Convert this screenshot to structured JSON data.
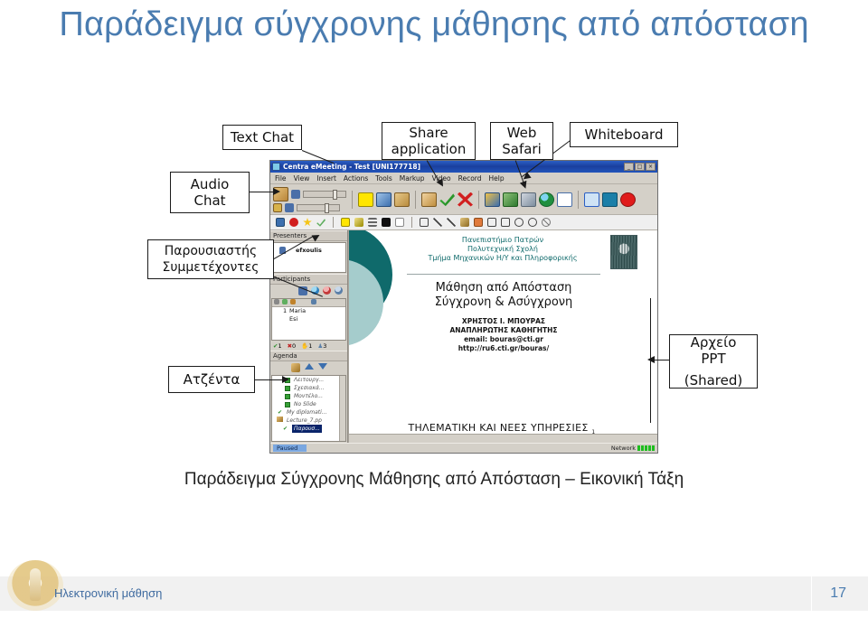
{
  "slide": {
    "title": "Παράδειγμα σύγχρονης μάθησης από απόσταση",
    "title_color": "#4a7cb0",
    "caption": "Παράδειγμα Σύγχρονης Μάθησης από Απόσταση – Εικονική Τάξη"
  },
  "footer": {
    "text": "Ηλεκτρονική μάθηση",
    "page_number": "17",
    "logo_icon": "university-crest-logo"
  },
  "callouts": [
    {
      "id": "text-chat",
      "lines": [
        "Text Chat"
      ]
    },
    {
      "id": "audio-chat",
      "lines": [
        "Audio",
        "Chat"
      ]
    },
    {
      "id": "presenters",
      "lines": [
        "Παρουσιαστής",
        "Συμμετέχοντες"
      ]
    },
    {
      "id": "agenda",
      "lines": [
        "Ατζέντα"
      ]
    },
    {
      "id": "share-app",
      "lines": [
        "Share",
        "application"
      ]
    },
    {
      "id": "web-safari",
      "lines": [
        "Web",
        "Safari"
      ]
    },
    {
      "id": "whiteboard",
      "lines": [
        "Whiteboard"
      ]
    },
    {
      "id": "ppt-file",
      "lines": [
        "Αρχείο",
        "PPT",
        "",
        "(Shared)"
      ]
    }
  ],
  "app": {
    "title": "Centra eMeeting - Test [UNI177718]",
    "window_buttons": [
      "_",
      "□",
      "×"
    ],
    "menu": [
      "File",
      "View",
      "Insert",
      "Actions",
      "Tools",
      "Markup",
      "Video",
      "Record",
      "Help"
    ],
    "panels": {
      "presenters_label": "Presenters",
      "presenter_name": "efxoulis",
      "participants_label": "Participants",
      "participants": [
        {
          "num": "1",
          "name": "Maria"
        },
        {
          "num": "",
          "name": "Esi"
        }
      ],
      "counts": [
        {
          "icon": "check-icon",
          "value": "1"
        },
        {
          "icon": "x-icon",
          "value": "0"
        },
        {
          "icon": "hand-icon",
          "value": "1"
        },
        {
          "icon": "person-icon",
          "value": "3"
        }
      ],
      "agenda_label": "Agenda",
      "agenda_items": [
        "Λειτουργ...",
        "Σχεσιακά...",
        "Μοντέλο...",
        "No Slide",
        "My diplomati...",
        "Lecture_7.pp",
        "Παρουσ..."
      ]
    },
    "stage": {
      "university_lines": [
        "Πανεπιστήμιο Πατρών",
        "Πολυτεχνική Σχολή",
        "Τμήμα Μηχανικών Η/Υ και Πληροφορικής"
      ],
      "crest_icon": "university-crest-icon",
      "heading_lines": [
        "Μάθηση από Απόσταση",
        "Σύγχρονη & Ασύγχρονη"
      ],
      "author_lines": [
        "ΧΡΗΣΤΟΣ Ι. ΜΠΟΥΡΑΣ",
        "ΑΝΑΠΛΗΡΩΤΗΣ ΚΑΘΗΓΗΤΗΣ",
        "email: bouras@cti.gr",
        "http://ru6.cti.gr/bouras/"
      ],
      "footer_text": "ΤΗΛΕΜΑΤΙΚΗ ΚΑΙ ΝΕΕΣ ΥΠΗΡΕΣΙΕΣ",
      "footer_page": "1",
      "circle_dark_color": "#0f6a6b",
      "circle_light_color": "#a5cccc",
      "heading_color": "#141414",
      "university_color": "#0f6a6b"
    },
    "status": {
      "state": "Paused",
      "network_label": "Network",
      "network_bars": 5
    }
  }
}
